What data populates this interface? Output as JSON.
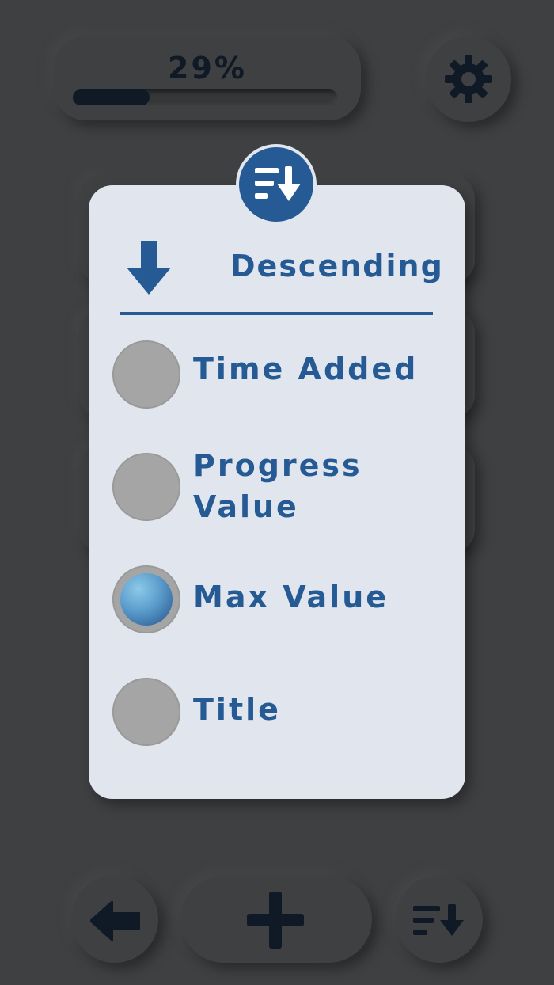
{
  "header": {
    "progress_text": "29%",
    "progress_fraction": 0.29
  },
  "sort_modal": {
    "order_label": "Descending",
    "options": [
      {
        "label": "Time Added",
        "selected": false
      },
      {
        "label": "Progress Value",
        "selected": false
      },
      {
        "label": "Max Value",
        "selected": true
      },
      {
        "label": "Title",
        "selected": false
      }
    ]
  },
  "icons": {
    "settings": "gear-icon",
    "sort_badge": "sort-descending-icon",
    "order": "arrow-down-icon",
    "back": "arrow-left-icon",
    "add": "plus-icon",
    "sort": "sort-descending-icon"
  },
  "colors": {
    "background": "#3f4042",
    "modal": "#e1e6ee",
    "accent": "#255a94",
    "dark_icon": "#0f1a26",
    "radio_off": "#a5a5a5"
  }
}
